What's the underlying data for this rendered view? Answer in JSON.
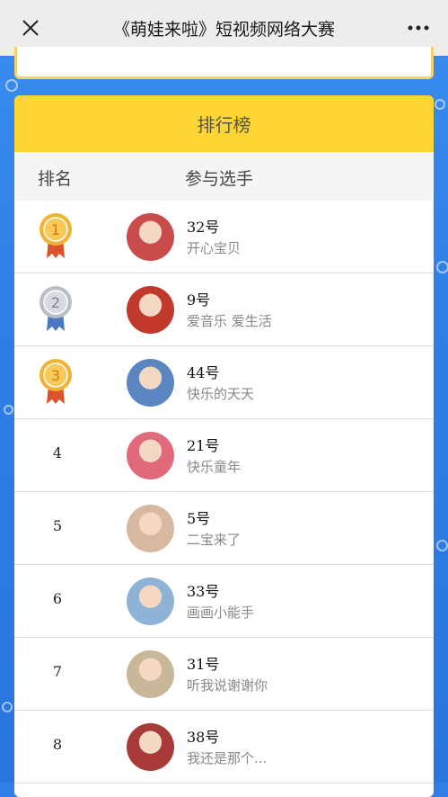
{
  "window": {
    "title": "《萌娃来啦》短视频网络大赛"
  },
  "leaderboard": {
    "title": "排行榜",
    "col_rank": "排名",
    "col_player": "参与选手",
    "rows": [
      {
        "rank": "1",
        "medal": "gold",
        "name": "32号",
        "desc": "开心宝贝",
        "avatar_color": "#c94b4b"
      },
      {
        "rank": "2",
        "medal": "silver",
        "name": "9号",
        "desc": "爱音乐 爱生活",
        "avatar_color": "#c0392b"
      },
      {
        "rank": "3",
        "medal": "gold",
        "name": "44号",
        "desc": "快乐的天天",
        "avatar_color": "#5b86c2"
      },
      {
        "rank": "4",
        "medal": "",
        "name": "21号",
        "desc": "快乐童年",
        "avatar_color": "#e06a7a"
      },
      {
        "rank": "5",
        "medal": "",
        "name": "5号",
        "desc": "二宝来了",
        "avatar_color": "#d8b8a0"
      },
      {
        "rank": "6",
        "medal": "",
        "name": "33号",
        "desc": "画画小能手",
        "avatar_color": "#8fb3d6"
      },
      {
        "rank": "7",
        "medal": "",
        "name": "31号",
        "desc": "听我说谢谢你",
        "avatar_color": "#c9b79a"
      },
      {
        "rank": "8",
        "medal": "",
        "name": "38号",
        "desc": "我还是那个...",
        "avatar_color": "#a83a3a"
      }
    ]
  },
  "colors": {
    "header_yellow": "#fcd433",
    "background_blue": "#2f7ee6"
  }
}
